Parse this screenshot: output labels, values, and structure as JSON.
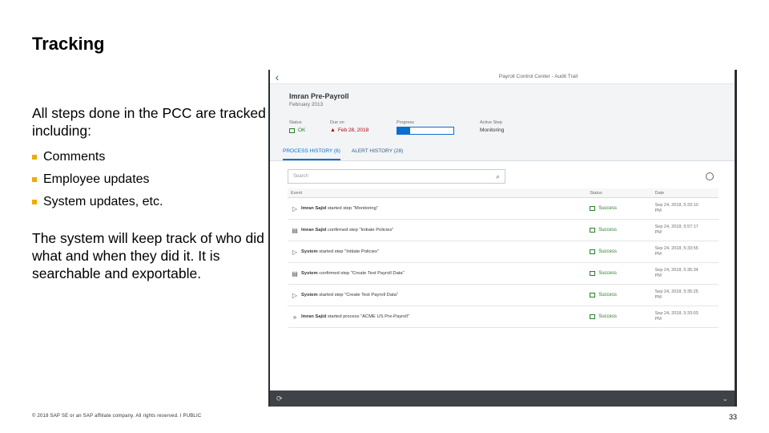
{
  "slide": {
    "title": "Tracking",
    "intro": "All steps done in the PCC are tracked including:",
    "bullets": [
      "Comments",
      "Employee updates",
      "System updates, etc."
    ],
    "outro": "The system will keep track of who did what and when they did it. It is searchable and exportable.",
    "footer": "© 2018 SAP SE or an SAP affiliate company. All rights reserved.  ǀ  PUBLIC",
    "page_number": "33",
    "accent_color": "#f0ab00"
  },
  "app": {
    "window_title": "Payroll Control Center - Audit Trail",
    "object_title": "Imran Pre-Payroll",
    "object_subtitle": "February 2013",
    "attributes": {
      "status_label": "Status",
      "status_value": "OK",
      "due_label": "Due on",
      "due_value": "Feb 28, 2018",
      "progress_label": "Progress",
      "progress_value": "3/13",
      "progress_fraction": 0.23,
      "active_label": "Active Step",
      "active_value": "Monitoring"
    },
    "tabs": [
      {
        "label": "PROCESS HISTORY (6)"
      },
      {
        "label": "ALERT HISTORY (28)"
      }
    ],
    "search_placeholder": "Search",
    "columns": {
      "event": "Event",
      "status": "Status",
      "date": "Date"
    },
    "rows": [
      {
        "icon": "play-forward-icon",
        "actor": "Imran Sajid",
        "action": " started step \"Monitoring\"",
        "status": "Success",
        "date1": "Sep 24, 2018, 5:33:10",
        "date2": "PM"
      },
      {
        "icon": "document-icon",
        "actor": "Imran Sajid",
        "action": " confirmed step \"Initiate Policies\"",
        "status": "Success",
        "date1": "Sep 24, 2018, 5:57:17",
        "date2": "PM"
      },
      {
        "icon": "play-forward-icon",
        "actor": "System",
        "action": " started step \"Initiate Policies\"",
        "status": "Success",
        "date1": "Sep 24, 2018, 5:33:55",
        "date2": "PM"
      },
      {
        "icon": "document-icon",
        "actor": "System",
        "action": " confirmed step \"Create Test Payroll Data\"",
        "status": "Success",
        "date1": "Sep 24, 2018, 5:35:34",
        "date2": "PM"
      },
      {
        "icon": "play-forward-icon",
        "actor": "System",
        "action": " started step \"Create Test Payroll Data\"",
        "status": "Success",
        "date1": "Sep 24, 2018, 5:35:25",
        "date2": "PM"
      },
      {
        "icon": "fast-forward-icon",
        "actor": "Imran Sajid",
        "action": " started process \"ACME US Pre-Payroll\"",
        "status": "Success",
        "date1": "Sep 24, 2018, 5:33:03",
        "date2": "PM"
      }
    ],
    "colors": {
      "header_bg": "#f2f4f6",
      "accent": "#0a6ed1",
      "success": "#2b7d2b",
      "error": "#bb0000",
      "footer_bar": "#3f4246"
    }
  }
}
